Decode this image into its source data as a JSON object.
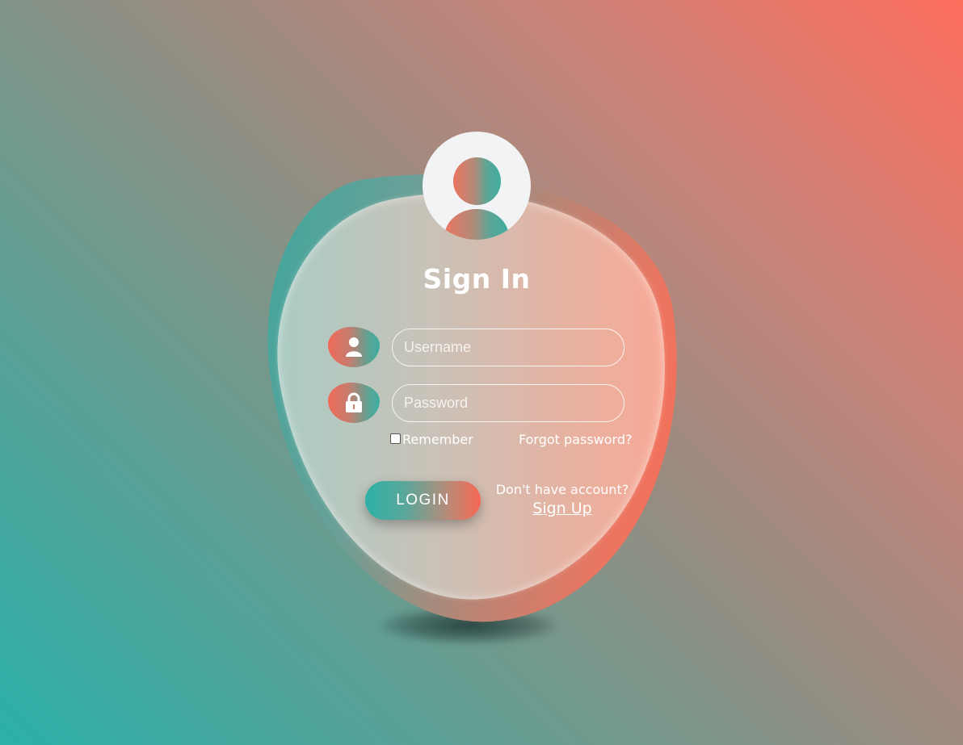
{
  "form": {
    "title": "Sign In",
    "username_placeholder": "Username",
    "password_placeholder": "Password",
    "remember_label": "Remember",
    "remember_checked": false,
    "forgot_label": "Forgot password?",
    "login_label": "LOGIN",
    "no_account_text": "Don't have account?",
    "signup_label": "Sign Up"
  },
  "icons": {
    "avatar": "user-avatar-icon",
    "username": "user-icon",
    "password": "lock-icon"
  },
  "colors": {
    "teal": "#2bb0a8",
    "coral": "#ff6f5e",
    "text": "#ffffff"
  }
}
